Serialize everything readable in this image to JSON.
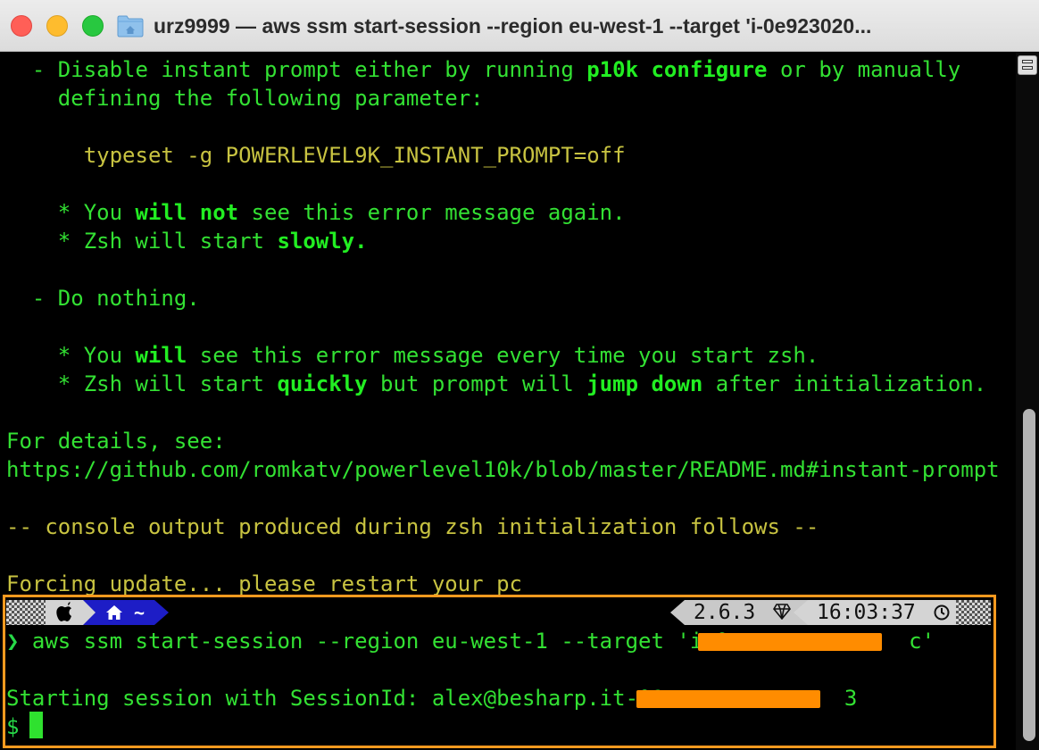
{
  "window": {
    "title": "urz9999 — aws ssm start-session --region eu-west-1 --target 'i-0e923020..."
  },
  "terminal": {
    "lines": [
      {
        "id": "l1",
        "parts": [
          "  - Disable instant prompt either by running ",
          "p10k configure",
          " or by manually"
        ]
      },
      {
        "id": "l2",
        "text": "    defining the following parameter:"
      },
      {
        "id": "l3",
        "text": "      typeset -g POWERLEVEL9K_INSTANT_PROMPT=off"
      },
      {
        "id": "l4",
        "parts": [
          "    * You ",
          "will not",
          " see this error message again."
        ]
      },
      {
        "id": "l5",
        "parts": [
          "    * Zsh will start ",
          "slowly."
        ]
      },
      {
        "id": "l6",
        "text": "  - Do nothing."
      },
      {
        "id": "l7",
        "parts": [
          "    * You ",
          "will",
          " see this error message every time you start zsh."
        ]
      },
      {
        "id": "l8",
        "parts": [
          "    * Zsh will start ",
          "quickly",
          " but prompt will ",
          "jump down",
          " after initialization."
        ]
      },
      {
        "id": "l9",
        "text": "For details, see:"
      },
      {
        "id": "l10",
        "text": "https://github.com/romkatv/powerlevel10k/blob/master/README.md#instant-prompt"
      },
      {
        "id": "l11",
        "text": "-- console output produced during zsh initialization follows --"
      },
      {
        "id": "l12",
        "text": "Forcing update... please restart your pc"
      }
    ],
    "prompt": {
      "apple_icon": "apple-icon",
      "home_icon": "home-icon",
      "dir": "~",
      "ruby_version": "2.6.3",
      "ruby_icon": "gem-icon",
      "time": "16:03:37",
      "clock_icon": "clock-icon"
    },
    "command": {
      "prompt_char": "❯",
      "text_before": " aws ssm start-session --region eu-west-1 --target 'i-0",
      "text_after": "c'"
    },
    "session": {
      "text_before": "Starting session with SessionId: alex@besharp.it-01",
      "text_after": "3"
    },
    "shell_prompt": "$"
  },
  "colors": {
    "text": "#33e133",
    "bold": "#22ee22",
    "yellow": "#c8c341",
    "highlight": "#ff9a1f",
    "redaction": "#ff8c00",
    "home_segment": "#1d1dc6"
  }
}
